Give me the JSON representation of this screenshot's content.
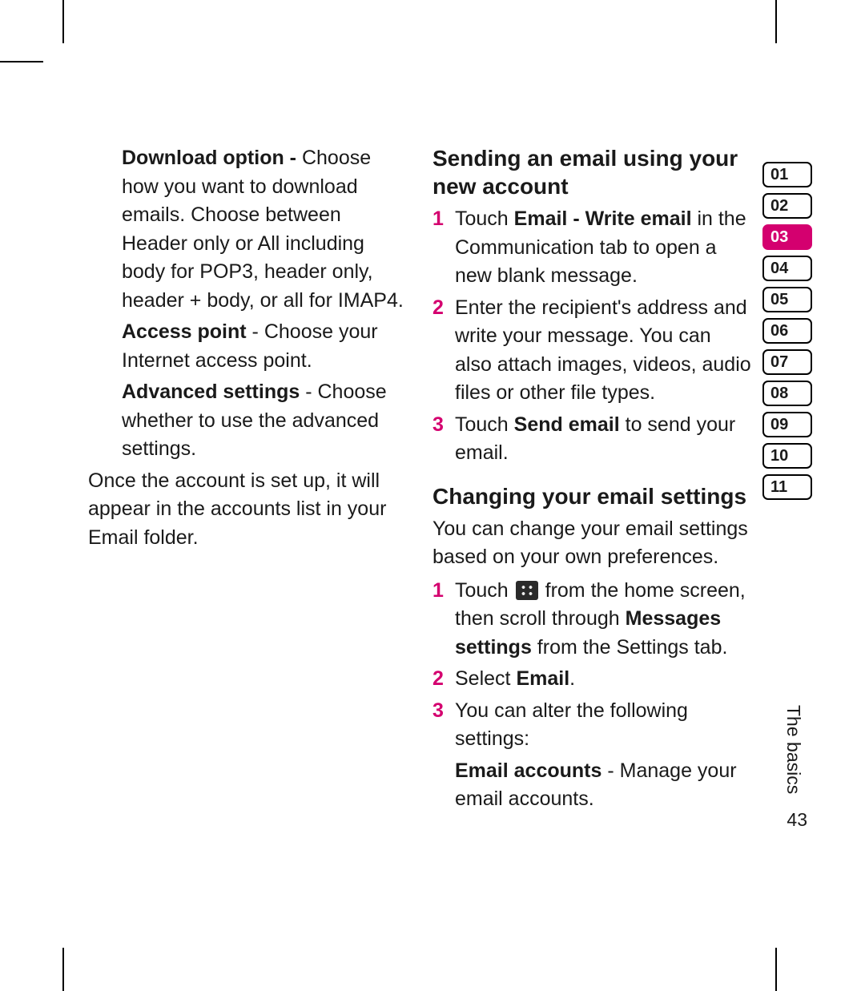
{
  "left": {
    "p1_bold": "Download option - ",
    "p1_rest": "Choose how you want to download emails. Choose between Header only or All including body for POP3, header only, header + body, or all for IMAP4.",
    "p2_bold": "Access point",
    "p2_rest": " - Choose your Internet access point.",
    "p3_bold": "Advanced settings",
    "p3_rest": " - Choose whether to use the advanced settings.",
    "p4": "Once the account is set up, it will appear in the accounts list in your Email folder."
  },
  "right": {
    "h1": "Sending an email using your new account",
    "s1_a": "Touch ",
    "s1_b": "Email - Write email",
    "s1_c": " in the Communication tab to open a new blank message.",
    "s2": "Enter the recipient's address and write your message. You can also attach images, videos, audio files or other file types.",
    "s3_a": "Touch ",
    "s3_b": "Send email",
    "s3_c": " to send your email.",
    "h2": "Changing your email settings",
    "intro": "You can change your email settings based on your own preferences.",
    "c1_a": "Touch ",
    "c1_b": " from the home screen, then scroll through ",
    "c1_c": "Messages settings",
    "c1_d": " from the Settings tab.",
    "c2_a": "Select ",
    "c2_b": "Email",
    "c2_c": ".",
    "c3": "You can alter the following settings:",
    "c3s_b": "Email accounts",
    "c3s_r": " - Manage your email accounts."
  },
  "nums": {
    "n1": "1",
    "n2": "2",
    "n3": "3"
  },
  "tabs": {
    "t01": "01",
    "t02": "02",
    "t03": "03",
    "t04": "04",
    "t05": "05",
    "t06": "06",
    "t07": "07",
    "t08": "08",
    "t09": "09",
    "t10": "10",
    "t11": "11"
  },
  "side_label": "The basics",
  "page_number": "43"
}
